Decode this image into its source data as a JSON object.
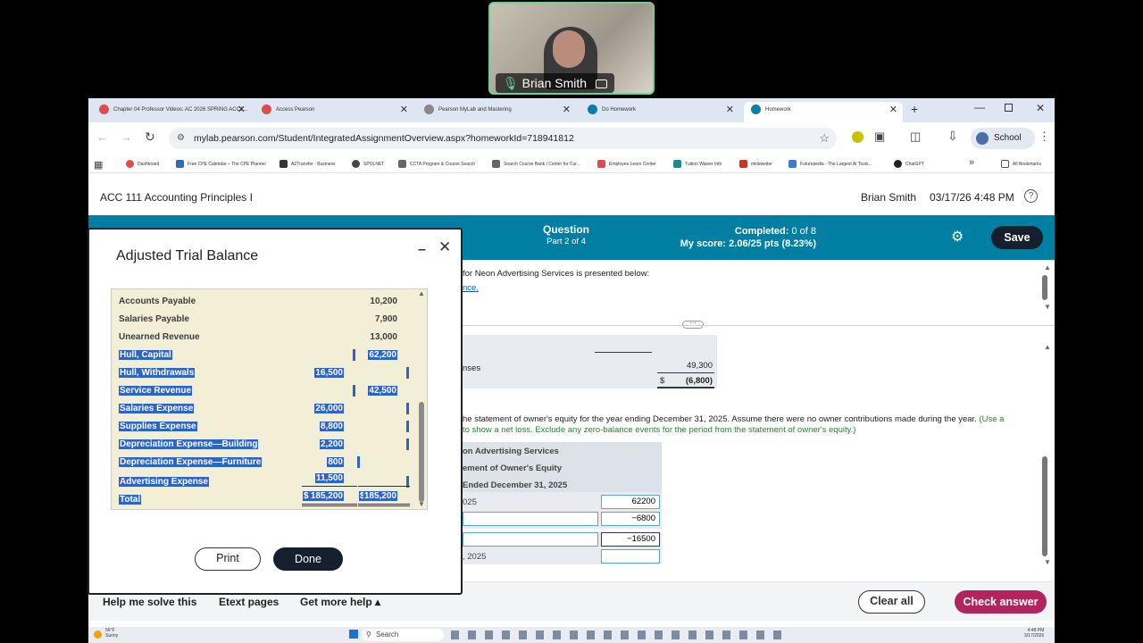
{
  "video": {
    "name": "Brian Smith"
  },
  "tabs": [
    {
      "label": "Chapter 04 Professor Videos: AC 2026 SPRING ACC1..."
    },
    {
      "label": "Access Pearson"
    },
    {
      "label": "Pearson MyLab and Mastering"
    },
    {
      "label": "Do Homework"
    },
    {
      "label": "Homework"
    }
  ],
  "address": {
    "url": "mylab.pearson.com/Student/IntegratedAssignmentOverview.aspx?homeworkId=718941812",
    "profile": "School"
  },
  "bookmarks": [
    "Dashboard",
    "Free CPE Calendar – The CPE Planner",
    "AZTransfer - Business",
    "SPOLNET",
    "CCTA Program & Course Search",
    "Search Course Bank | Center for Cur...",
    "Employee Learn Center",
    "Tuition Waiver Info",
    "mkleweiter",
    "Futurepedia - The Largest AI Tools...",
    "ChatGPT",
    "All Bookmarks"
  ],
  "header": {
    "course": "ACC 111 Accounting Principles I",
    "user": "Brian Smith",
    "datetime": "03/17/26 4:48 PM"
  },
  "question_bar": {
    "question_label": "Question",
    "part": "Part 2 of 4",
    "completed_label": "Completed:",
    "completed_value": "0 of 8",
    "score_label": "My score:",
    "score_value": "2.06/25 pts (8.23%)",
    "save": "Save"
  },
  "modal": {
    "title": "Adjusted Trial Balance",
    "rows": [
      {
        "label": "Accounts Payable",
        "debit": "",
        "credit": "10,200"
      },
      {
        "label": "Salaries Payable",
        "debit": "",
        "credit": "7,900"
      },
      {
        "label": "Unearned Revenue",
        "debit": "",
        "credit": "13,000"
      },
      {
        "label": "Hull, Capital",
        "debit": "",
        "credit": "62,200"
      },
      {
        "label": "Hull, Withdrawals",
        "debit": "16,500",
        "credit": ""
      },
      {
        "label": "Service Revenue",
        "debit": "",
        "credit": "42,500"
      },
      {
        "label": "Salaries Expense",
        "debit": "26,000",
        "credit": ""
      },
      {
        "label": "Supplies Expense",
        "debit": "8,800",
        "credit": ""
      },
      {
        "label": "Depreciation Expense—Building",
        "debit": "2,200",
        "credit": ""
      },
      {
        "label": "Depreciation Expense—Furniture",
        "debit": "800",
        "credit": ""
      },
      {
        "label": "Advertising Expense",
        "debit": "11,500",
        "credit": ""
      }
    ],
    "total": {
      "label": "Total",
      "dollar": "$",
      "debit": "185,200",
      "credit": "185,200"
    },
    "print": "Print",
    "done": "Done"
  },
  "content": {
    "intro": "for Neon Advertising Services is presented below:",
    "link": "nce.",
    "income": {
      "expenses_label": "nses",
      "expenses_total": "49,300",
      "dollar": "$",
      "net_loss": "(6,800)"
    },
    "instruction_black": "he statement of owner's equity for the year ending December 31, 2025. Assume there were no owner contributions made during the year.",
    "instruction_green_1": "(Use a",
    "instruction_green_2": "to show a net loss. Exclude any zero-balance events for the period from the statement of owner's equity.)",
    "statement": {
      "line1": "on Advertising Services",
      "line2": "ement of Owner's Equity",
      "line3": "Ended December 31, 2025",
      "row1_label": "025",
      "row1_value": "62200",
      "row2_value": "−6800",
      "row3_value": "−16500",
      "row4_label": ", 2025",
      "row4_value": ""
    }
  },
  "bottom": {
    "help": "Help me solve this",
    "etext": "Etext pages",
    "more": "Get more help ▴",
    "clear": "Clear all",
    "check": "Check answer"
  },
  "taskbar": {
    "weather_temp": "56°F",
    "weather_desc": "Sunny",
    "search": "Search",
    "time": "4:48 PM",
    "date": "3/17/2026"
  }
}
